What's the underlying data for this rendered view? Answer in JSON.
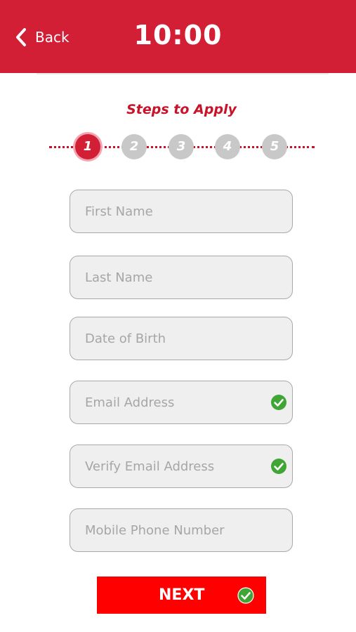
{
  "header": {
    "back_label": "Back",
    "time": "10:00",
    "color": "#d31f35"
  },
  "steps": {
    "title": "Steps to Apply",
    "items": [
      "1",
      "2",
      "3",
      "4",
      "5"
    ],
    "active_index": 0
  },
  "form": {
    "fields": [
      {
        "placeholder": "First Name",
        "value": "",
        "verified": false
      },
      {
        "placeholder": "Last Name",
        "value": "",
        "verified": false
      },
      {
        "placeholder": "Date of Birth",
        "value": "",
        "verified": false
      },
      {
        "placeholder": "Email Address",
        "value": "",
        "verified": true
      },
      {
        "placeholder": "Verify Email Address",
        "value": "",
        "verified": true
      },
      {
        "placeholder": "Mobile Phone Number",
        "value": "",
        "verified": false
      }
    ]
  },
  "next_button": {
    "label": "NEXT",
    "color": "#ff0000",
    "icon": "check-circle-icon"
  },
  "icons": {
    "back": "chevron-left-icon",
    "verified": "check-circle-icon",
    "check_color": "#3fa535"
  }
}
